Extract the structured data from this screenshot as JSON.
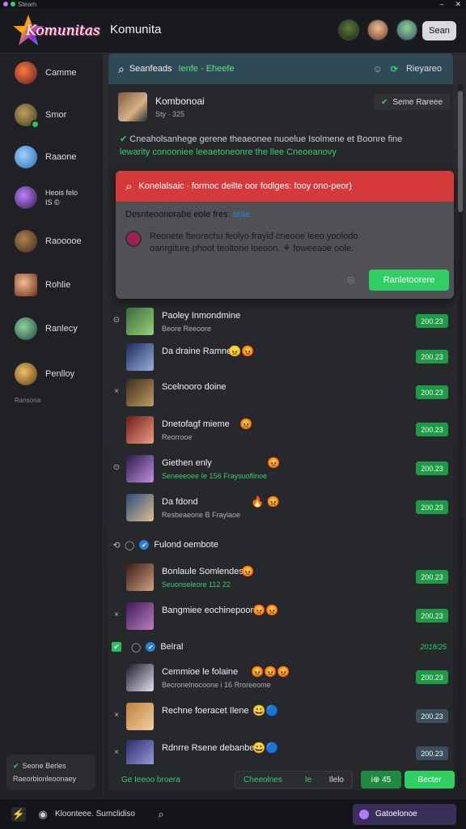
{
  "titlebar": {
    "title": "Steam",
    "minimize": "–",
    "close": "✕"
  },
  "header": {
    "logo_text": "Komunitas",
    "app_title": "Komunita",
    "button_label": "Sean",
    "avatars": [
      "avatar-1",
      "avatar-2",
      "avatar-3"
    ]
  },
  "sidebar": {
    "items": [
      {
        "label": "Camme",
        "icon": "game-icon-red"
      },
      {
        "label": "Smor",
        "icon": "game-icon-olive"
      },
      {
        "label": "Raaone",
        "icon": "game-icon-blue"
      },
      {
        "label": "Heois felo\nIS ©",
        "icon": "game-icon-purple"
      },
      {
        "label": "Raooooe",
        "icon": "game-icon-brown"
      },
      {
        "label": "Rohlie",
        "icon": "game-icon-warrior"
      },
      {
        "label": "Ranlecy",
        "icon": "game-icon-green"
      },
      {
        "label": "Penlloy",
        "icon": "game-icon-gold"
      }
    ],
    "footer_label": "Ransona",
    "card_line1": "Seone Berles",
    "card_line2": "Raeorbionleoonaey"
  },
  "search": {
    "query": "Seanfeads",
    "hint": "Ienfe - Eheefe",
    "right_label": "Rieyareo"
  },
  "profile": {
    "name": "Kombonoai",
    "sub": "Sty · 325",
    "status": "Seme Rareee"
  },
  "description": {
    "line1": "Cneaholsanhege gerene theaeonee nuoelue Isolmene et Boonre fine",
    "line2": "lewarity conooniee leeaetoneonre the llee Cneoeanovy"
  },
  "modal": {
    "title": "Konelalsaic ∙ formoc deilte oor fodlges: fooy ono-peor)",
    "subtitle": "Desnteoonorabe eole fres:",
    "subtitle_link": "teae",
    "message_line1": "Reonete fteorechu feolyo frayld cneooe leeo yoolodo",
    "message_line2": "oanrgiture phoot teoltone loeoon. ⚘ foweeaoe oole.",
    "button": "Ranletoorere"
  },
  "rows": [
    {
      "lead": "⊙",
      "title": "Paoley Inmondmine",
      "sub": "Beore Reeoore",
      "sub_green": false,
      "emoji": "",
      "badge": "200.23"
    },
    {
      "lead": "",
      "title": "Da draine Ramne",
      "sub": "",
      "sub_green": false,
      "emoji": "😠😡",
      "badge": "200.23"
    },
    {
      "lead": "×",
      "title": "Scelnooro doine",
      "sub": "",
      "sub_green": false,
      "emoji": "",
      "badge": "200.23"
    },
    {
      "lead": "",
      "title": "Dnetofagf mieme",
      "sub": "Reorrooe",
      "sub_green": false,
      "emoji": "😡",
      "badge": "200.23"
    },
    {
      "lead": "⊙",
      "title": "Giethen enly",
      "sub": "Seneeeoee Ie 156 Fraysuoflinoe",
      "sub_green": true,
      "emoji": "😡",
      "badge": "200.23"
    },
    {
      "lead": "",
      "title": "Da fdond",
      "sub": "Resbeaeone B Fraylaoe",
      "sub_green": false,
      "emoji": "🔥  😡",
      "badge": "200.23"
    }
  ],
  "section1": {
    "lead": "⟲",
    "mark": "◯",
    "label": "Fulond oembote"
  },
  "rows2": [
    {
      "lead": "",
      "title": "Bonlaule Somlendes",
      "sub": "Seuonseleore 112 22",
      "sub_green": true,
      "emoji": "😡",
      "badge": "200.23"
    },
    {
      "lead": "×",
      "title": "Bangmiee eochinepoore",
      "sub": "",
      "sub_green": false,
      "emoji": "😡😡",
      "badge": "200.23"
    }
  ],
  "section2": {
    "label": "Belral",
    "right": "2018/25"
  },
  "rows3": [
    {
      "lead": "",
      "title": "Cemmioe le folaine",
      "sub": "Becronelnocoone i 16 Rroreeome",
      "sub_green": false,
      "emoji": "😡😡😡",
      "badge": "200.23",
      "grey": false
    },
    {
      "lead": "×",
      "title": "Rechne foeracet Ilene",
      "sub": "",
      "sub_green": false,
      "emoji": "😀🔵",
      "badge": "200.23",
      "grey": true
    },
    {
      "lead": "×",
      "title": "Rdnrre Rsene debanbes.",
      "sub": "",
      "sub_green": false,
      "emoji": "😀🔵",
      "badge": "200.23",
      "grey": true
    }
  ],
  "bottombar": {
    "left": "Ge  Ieeoo broera",
    "pill_left": "Cheeolnes",
    "pill_mid": "Ie",
    "pill_right": "Ilelo",
    "btn1": "i⊕ 45",
    "btn2": "Becter"
  },
  "taskbar": {
    "label": "Kloonteee. Sumclidiso",
    "right_label": "Gatoelonoe"
  },
  "colors": {
    "accent_green": "#2fcf63",
    "alert_red": "#d6393a",
    "search_bg": "#2f4a56"
  }
}
